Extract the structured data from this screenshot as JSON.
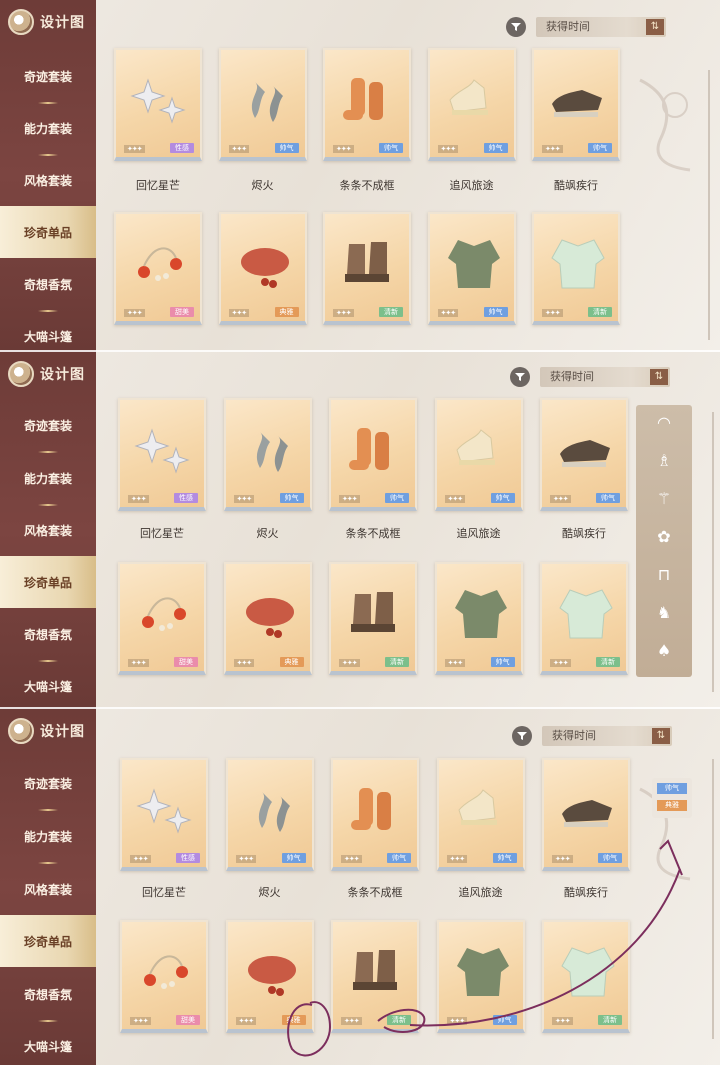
{
  "sidebar": {
    "title": "设计图",
    "items": [
      {
        "label": "奇迹套装"
      },
      {
        "label": "能力套装"
      },
      {
        "label": "风格套装"
      },
      {
        "label": "珍奇单品",
        "active": true
      },
      {
        "label": "奇想香氛"
      },
      {
        "label": "大喵斗篷"
      }
    ]
  },
  "sort": {
    "label": "获得时间",
    "direction_icon": "sort-toggle-icon"
  },
  "items_row1": [
    {
      "name": "回忆星芒",
      "tag": "性感",
      "tag_color": "#b38be0",
      "stars": "✦✦✦",
      "icon": "star-earrings"
    },
    {
      "name": "烬火",
      "tag": "帅气",
      "tag_color": "#6f9fe0",
      "stars": "✦✦✦",
      "icon": "flame-earrings"
    },
    {
      "name": "条条不成框",
      "tag": "帅气",
      "tag_color": "#6f9fe0",
      "stars": "✦✦✦",
      "icon": "socks"
    },
    {
      "name": "追风旅途",
      "tag": "帅气",
      "tag_color": "#6f9fe0",
      "stars": "✦✦✦",
      "icon": "sneakers"
    },
    {
      "name": "酷飒疾行",
      "tag": "帅气",
      "tag_color": "#6f9fe0",
      "stars": "✦✦✦",
      "icon": "loafers"
    }
  ],
  "items_row2": [
    {
      "tag": "甜美",
      "tag_color": "#ea8cab",
      "stars": "✦✦✦",
      "icon": "cherry-bracelet"
    },
    {
      "tag": "典雅",
      "tag_color": "#e49a58",
      "stars": "✦✦✦",
      "icon": "beret"
    },
    {
      "tag": "清新",
      "tag_color": "#7cbf8b",
      "stars": "✦✦✦",
      "icon": "boots"
    },
    {
      "tag": "帅气",
      "tag_color": "#6f9fe0",
      "stars": "✦✦✦",
      "icon": "jacket"
    },
    {
      "tag": "清新",
      "tag_color": "#7cbf8b",
      "stars": "✦✦✦",
      "icon": "cardigan"
    }
  ],
  "category_rail_icons": [
    "headwear-icon",
    "dress-icon",
    "coat-icon",
    "top-icon",
    "bottom-icon",
    "socks-icon",
    "shoes-icon"
  ],
  "tag_popup": [
    {
      "label": "帅气",
      "color": "#6f9fe0"
    },
    {
      "label": "典雅",
      "color": "#e49a58"
    }
  ],
  "annotation": {
    "stroke_color": "#7c2e5d"
  }
}
